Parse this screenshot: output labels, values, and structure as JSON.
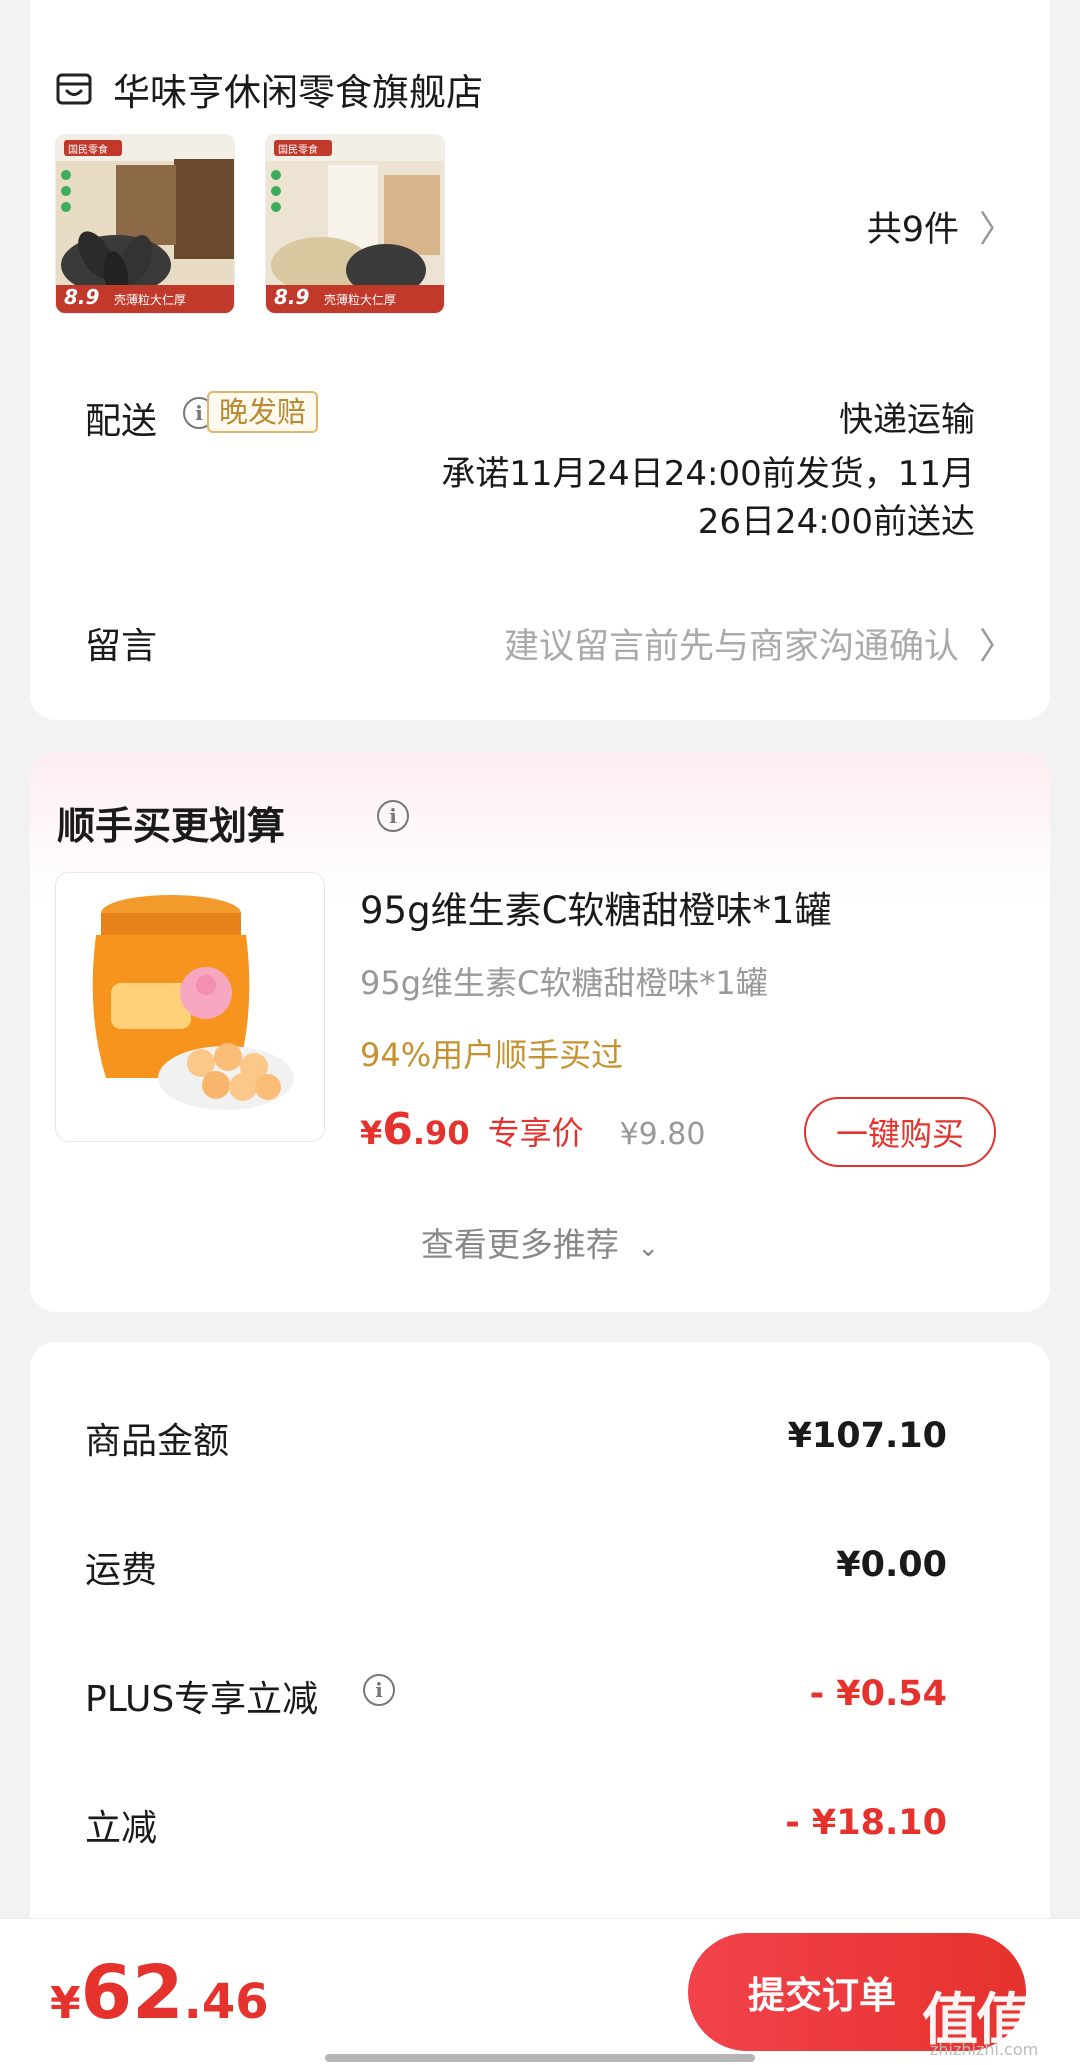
{
  "store": {
    "name": "华味亨休闲零食旗舰店",
    "icon": "store-icon"
  },
  "items": {
    "thumbs": [
      {
        "brand": "国民零食",
        "price_tag": "8.9",
        "caption": "壳薄粒大仁厚"
      },
      {
        "brand": "国民零食",
        "price_tag": "8.9",
        "caption": "壳薄粒大仁厚"
      }
    ],
    "count_label": "共9件"
  },
  "delivery": {
    "label": "配送",
    "badge": "晚发赔",
    "method": "快递运输",
    "promise_line1": "承诺11月24日24:00前发货，11月",
    "promise_line2": "26日24:00前送达"
  },
  "message": {
    "label": "留言",
    "placeholder": "建议留言前先与商家沟通确认"
  },
  "upsell": {
    "title": "顺手买更划算",
    "product": {
      "title": "95g维生素C软糖甜橙味*1罐",
      "subtitle": "95g维生素C软糖甜橙味*1罐",
      "stat": "94%用户顺手买过",
      "price_symbol": "¥",
      "price_int": "6",
      "price_dec": ".90",
      "price_tag": "专享价",
      "original_price": "¥9.80",
      "buy_label": "一键购买"
    },
    "more_label": "查看更多推荐"
  },
  "summary": {
    "rows": [
      {
        "label": "商品金额",
        "value": "¥107.10"
      },
      {
        "label": "运费",
        "value": "¥0.00"
      },
      {
        "label": "PLUS专享立减",
        "value": "- ¥0.54"
      },
      {
        "label": "立减",
        "value": "- ¥18.10"
      }
    ]
  },
  "footer": {
    "total_symbol": "¥",
    "total_int": "62",
    "total_dec": ".46",
    "submit_label": "提交订单",
    "watermark": "值值值",
    "watermark_site": "zhizhizhi.com"
  },
  "colors": {
    "accent_red": "#e5322d",
    "gold": "#c6922f",
    "muted": "#999999"
  }
}
